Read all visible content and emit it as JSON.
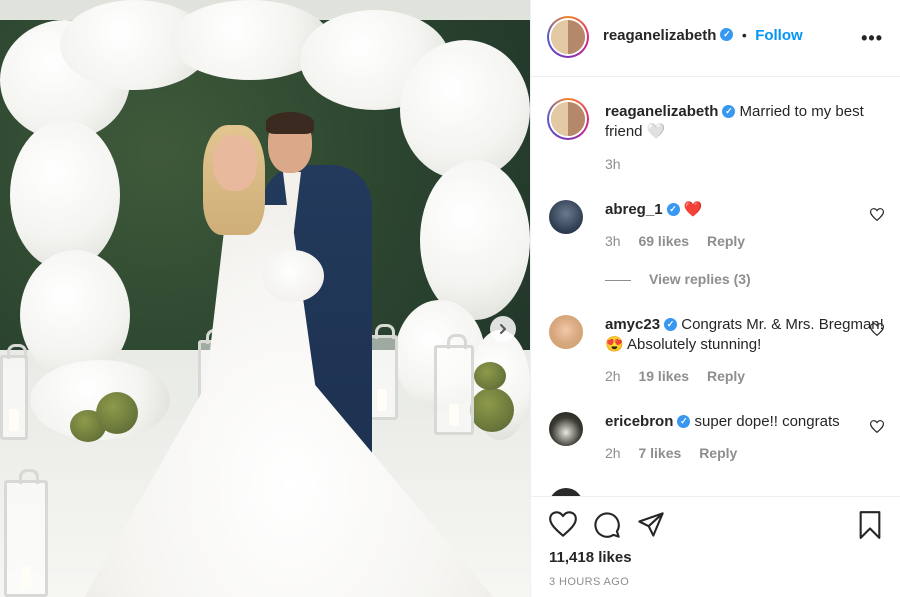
{
  "post": {
    "author": "reaganelizabeth",
    "follow_label": "Follow",
    "dot": "•",
    "more_label": "•••",
    "caption_text": "Married to my best friend 🤍",
    "caption_age": "3h",
    "likes": "11,418 likes",
    "timestamp": "3 HOURS AGO"
  },
  "comments": [
    {
      "user": "abreg_1",
      "text": "❤️",
      "age": "3h",
      "likes": "69 likes",
      "reply": "Reply",
      "view_replies": "View replies (3)"
    },
    {
      "user": "amyc23",
      "text": "Congrats Mr. & Mrs. Bregman! 😍 Absolutely stunning!",
      "age": "2h",
      "likes": "19 likes",
      "reply": "Reply"
    },
    {
      "user": "ericebron",
      "text": "super dope!! congrats",
      "age": "2h",
      "likes": "7 likes",
      "reply": "Reply"
    }
  ],
  "colors": {
    "accent": "#0095f6",
    "verified": "#3897f0",
    "muted": "#8e8e8e",
    "text": "#262626"
  },
  "icons": [
    "verified-badge-icon",
    "more-options-icon",
    "heart-icon",
    "comment-icon",
    "share-icon",
    "bookmark-icon",
    "carousel-next-icon"
  ]
}
